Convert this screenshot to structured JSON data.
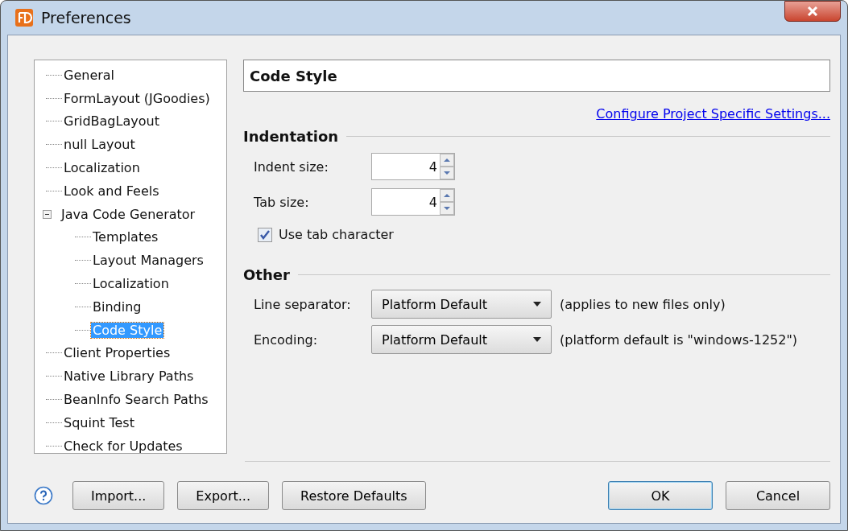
{
  "window": {
    "title": "Preferences"
  },
  "tree": [
    {
      "label": "General",
      "selected": false
    },
    {
      "label": "FormLayout (JGoodies)",
      "selected": false
    },
    {
      "label": "GridBagLayout",
      "selected": false
    },
    {
      "label": "null Layout",
      "selected": false
    },
    {
      "label": "Localization",
      "selected": false
    },
    {
      "label": "Look and Feels",
      "selected": false
    },
    {
      "label": "Java Code Generator",
      "selected": false,
      "expanded": true,
      "children": [
        {
          "label": "Templates",
          "selected": false
        },
        {
          "label": "Layout Managers",
          "selected": false
        },
        {
          "label": "Localization",
          "selected": false
        },
        {
          "label": "Binding",
          "selected": false
        },
        {
          "label": "Code Style",
          "selected": true
        }
      ]
    },
    {
      "label": "Client Properties",
      "selected": false
    },
    {
      "label": "Native Library Paths",
      "selected": false
    },
    {
      "label": "BeanInfo Search Paths",
      "selected": false
    },
    {
      "label": "Squint Test",
      "selected": false
    },
    {
      "label": "Check for Updates",
      "selected": false
    }
  ],
  "page_title": "Code Style",
  "link": "Configure Project Specific Settings...",
  "indentation": {
    "heading": "Indentation",
    "spinners": [
      {
        "label": "Indent size:",
        "value": "4"
      },
      {
        "label": "Tab size:",
        "value": "4"
      }
    ],
    "checkbox": {
      "label": "Use tab character",
      "checked": true
    }
  },
  "other": {
    "heading": "Other",
    "dropdowns": [
      {
        "label": "Line separator:",
        "value": "Platform Default",
        "note": "(applies to new files only)"
      },
      {
        "label": "Encoding:",
        "value": "Platform Default",
        "note": "(platform default is \"windows-1252\")"
      }
    ]
  },
  "buttons_left": [
    "Import...",
    "Export...",
    "Restore Defaults"
  ],
  "buttons_right": [
    {
      "label": "OK",
      "default": true
    },
    {
      "label": "Cancel",
      "default": false
    }
  ]
}
